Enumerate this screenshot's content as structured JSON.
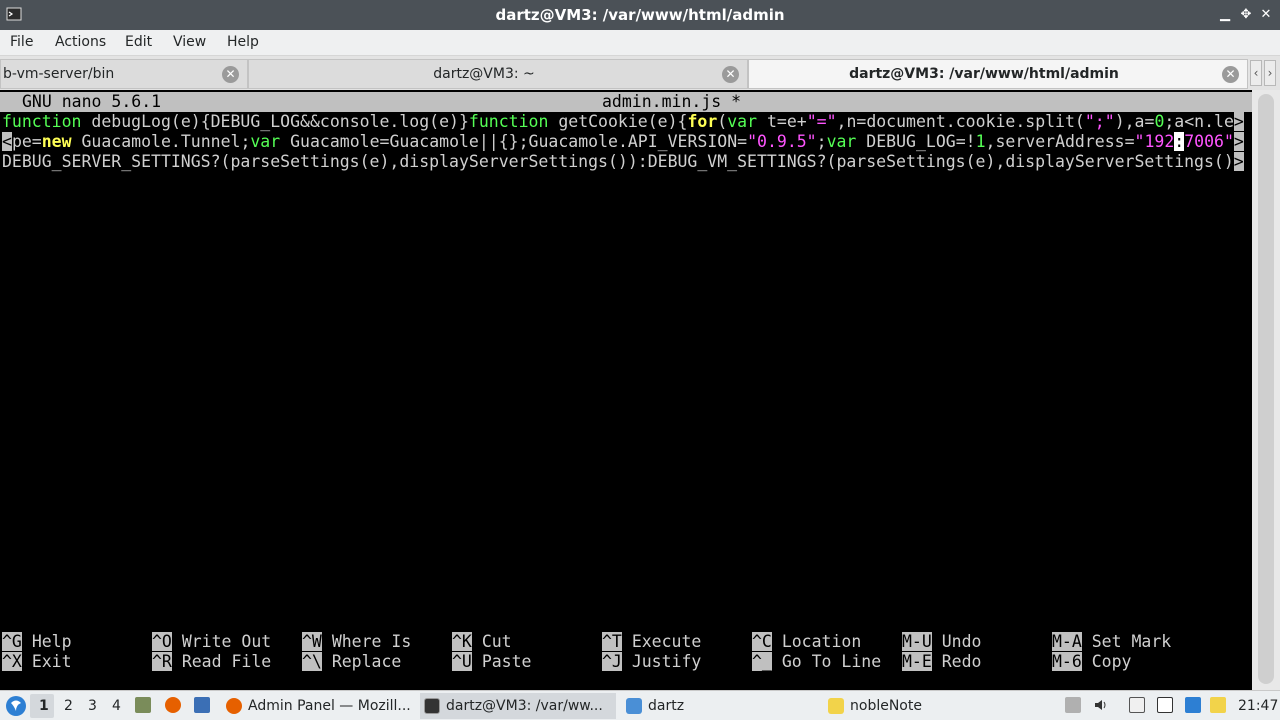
{
  "window": {
    "title": "dartz@VM3: /var/www/html/admin"
  },
  "menu": [
    "File",
    "Actions",
    "Edit",
    "View",
    "Help"
  ],
  "tabs": [
    {
      "label": "b-vm-server/bin"
    },
    {
      "label": "dartz@VM3: ~"
    },
    {
      "label": "dartz@VM3: /var/www/html/admin"
    }
  ],
  "nano": {
    "version": "GNU nano 5.6.1",
    "filename": "admin.min.js *",
    "line1": {
      "t1": "function",
      "t2": " debugLog(e){DEBUG_LOG&&console.log(e)}",
      "t3": "function",
      "t4": " getCookie(e){",
      "t5": "for",
      "t6": "(",
      "t7": "var",
      "t8": " t=e+",
      "t9": "\"=\"",
      "t10": ",n=document.cookie.split(",
      "t11": "\";\"",
      "t12": "),a=",
      "t13": "0",
      "t14": ";a<n.le",
      "end": ">"
    },
    "line2": {
      "t0": "<",
      "t1": "pe=",
      "t2": "new",
      "t3": " Guacamole.Tunnel;",
      "t4": "var",
      "t5": " Guacamole=Guacamole||{};Guacamole.API_VERSION=",
      "t6": "\"0.9.5\"",
      "t7": ";",
      "t8": "var",
      "t9": " DEBUG_LOG=!",
      "t10": "1",
      "t11": ",serverAddress=",
      "t12": "\"192",
      "t13": ":",
      "t14": "7006\"",
      "end": ">"
    },
    "line3": {
      "t1": "DEBUG_SERVER_SETTINGS?(parseSettings(e),displayServerSettings()):DEBUG_VM_SETTINGS?(parseSettings(e),displayServerSettings()",
      "end": ">"
    },
    "shortcuts": [
      {
        "key": "^G",
        "label": "Help"
      },
      {
        "key": "^X",
        "label": "Exit"
      },
      {
        "key": "^O",
        "label": "Write Out"
      },
      {
        "key": "^R",
        "label": "Read File"
      },
      {
        "key": "^W",
        "label": "Where Is"
      },
      {
        "key": "^\\",
        "label": "Replace"
      },
      {
        "key": "^K",
        "label": "Cut"
      },
      {
        "key": "^U",
        "label": "Paste"
      },
      {
        "key": "^T",
        "label": "Execute"
      },
      {
        "key": "^J",
        "label": "Justify"
      },
      {
        "key": "^C",
        "label": "Location"
      },
      {
        "key": "^_",
        "label": "Go To Line"
      },
      {
        "key": "M-U",
        "label": "Undo"
      },
      {
        "key": "M-E",
        "label": "Redo"
      },
      {
        "key": "M-A",
        "label": "Set Mark"
      },
      {
        "key": "M-6",
        "label": "Copy"
      }
    ]
  },
  "taskbar": {
    "workspaces": [
      "1",
      "2",
      "3",
      "4"
    ],
    "tasks": [
      {
        "label": "Admin Panel — Mozill...",
        "icon": "firefox-icon"
      },
      {
        "label": "dartz@VM3: /var/ww...",
        "icon": "terminal-icon"
      },
      {
        "label": "dartz",
        "icon": "folder-icon"
      },
      {
        "label": "nobleNote",
        "icon": "note-icon"
      }
    ],
    "clock": "21:47"
  }
}
